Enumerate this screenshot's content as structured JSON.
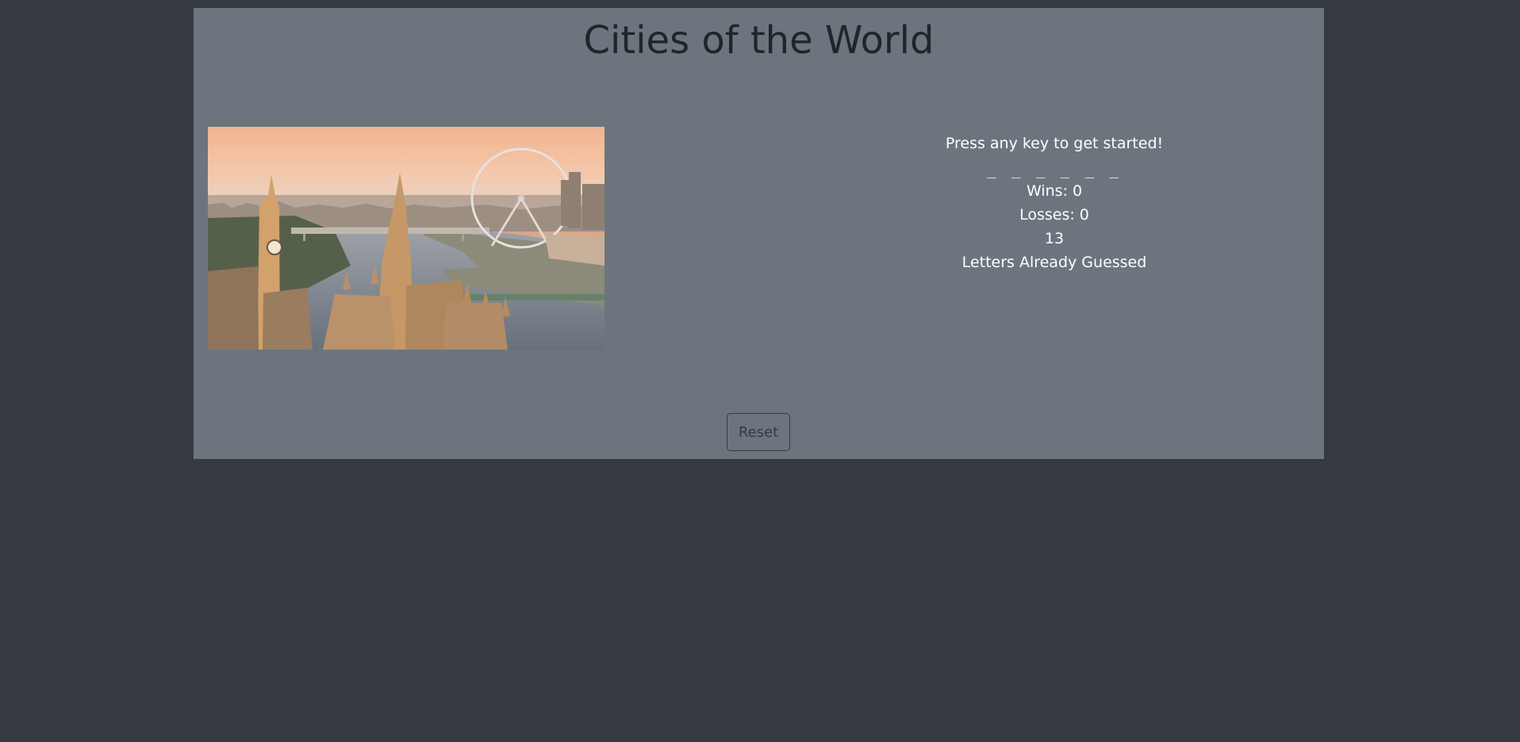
{
  "page": {
    "title": "Cities of the World"
  },
  "game": {
    "prompt": "Press any key to get started!",
    "word_blanks": "_ _ _ _ _ _",
    "wins_label": "Wins: 0",
    "losses_label": "Losses: 0",
    "guesses_remaining": "13",
    "letters_guessed_label": "Letters Already Guessed"
  },
  "controls": {
    "reset_label": "Reset"
  },
  "colors": {
    "background": "#343a40",
    "panel": "#6c757d",
    "title": "#212529",
    "text": "#ffffff"
  }
}
